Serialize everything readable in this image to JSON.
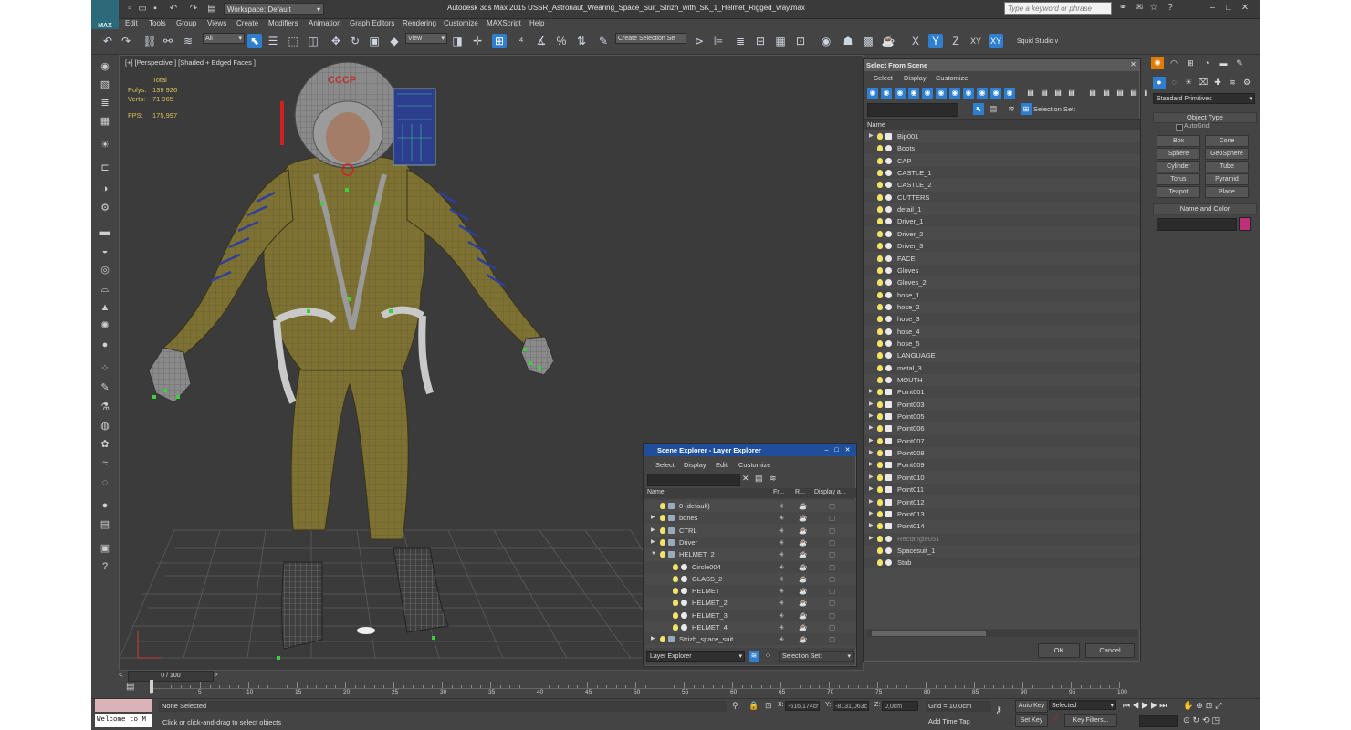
{
  "titlebar": {
    "workspace": "Workspace: Default",
    "app_title": "Autodesk 3ds Max  2015    USSR_Astronaut_Wearing_Space_Suit_Strizh_with_SK_1_Helmet_Rigged_vray.max",
    "search_placeholder": "Type a keyword or phrase",
    "logo": "MAX"
  },
  "menus": [
    "Edit",
    "Tools",
    "Group",
    "Views",
    "Create",
    "Modifiers",
    "Animation",
    "Graph Editors",
    "Rendering",
    "Customize",
    "MAXScript",
    "Help"
  ],
  "toolbar": {
    "filter": "All",
    "ref_coord": "View",
    "selection_set_placeholder": "Create Selection Se",
    "axis_labels": [
      "X",
      "Y",
      "Z",
      "XY",
      "XY"
    ],
    "squid": "Squid Studio v"
  },
  "viewport": {
    "label": "[+] [Perspective ] [Shaded + Edged Faces ]",
    "stats_total": "Total",
    "polys_label": "Polys:",
    "polys_value": "139 926",
    "verts_label": "Verts:",
    "verts_value": "71 965",
    "fps_label": "FPS:",
    "fps_value": "175,997",
    "helmet_text": "СССР"
  },
  "select_from_scene": {
    "title": "Select From Scene",
    "menus": [
      "Select",
      "Display",
      "Customize"
    ],
    "selection_set": "Selection Set:",
    "column_name": "Name",
    "items": [
      {
        "name": "Bip001",
        "expand": true,
        "icon": "bone"
      },
      {
        "name": "Boots",
        "expand": false,
        "icon": "mesh"
      },
      {
        "name": "CAP",
        "expand": false,
        "icon": "mesh"
      },
      {
        "name": "CASTLE_1",
        "expand": false,
        "icon": "mesh"
      },
      {
        "name": "CASTLE_2",
        "expand": false,
        "icon": "mesh"
      },
      {
        "name": "CUTTERS",
        "expand": false,
        "icon": "mesh"
      },
      {
        "name": "detail_1",
        "expand": false,
        "icon": "mesh"
      },
      {
        "name": "Driver_1",
        "expand": false,
        "icon": "mesh"
      },
      {
        "name": "Driver_2",
        "expand": false,
        "icon": "mesh"
      },
      {
        "name": "Driver_3",
        "expand": false,
        "icon": "mesh"
      },
      {
        "name": "FACE",
        "expand": false,
        "icon": "mesh"
      },
      {
        "name": "Gloves",
        "expand": false,
        "icon": "mesh"
      },
      {
        "name": "Gloves_2",
        "expand": false,
        "icon": "mesh"
      },
      {
        "name": "hose_1",
        "expand": false,
        "icon": "mesh"
      },
      {
        "name": "hose_2",
        "expand": false,
        "icon": "mesh"
      },
      {
        "name": "hose_3",
        "expand": false,
        "icon": "mesh"
      },
      {
        "name": "hose_4",
        "expand": false,
        "icon": "mesh"
      },
      {
        "name": "hose_5",
        "expand": false,
        "icon": "mesh"
      },
      {
        "name": "LANGUAGE",
        "expand": false,
        "icon": "mesh"
      },
      {
        "name": "metal_3",
        "expand": false,
        "icon": "mesh"
      },
      {
        "name": "MOUTH",
        "expand": false,
        "icon": "mesh"
      },
      {
        "name": "Point001",
        "expand": true,
        "icon": "helper"
      },
      {
        "name": "Point003",
        "expand": true,
        "icon": "helper"
      },
      {
        "name": "Point005",
        "expand": true,
        "icon": "helper"
      },
      {
        "name": "Point006",
        "expand": true,
        "icon": "helper"
      },
      {
        "name": "Point007",
        "expand": true,
        "icon": "helper"
      },
      {
        "name": "Point008",
        "expand": true,
        "icon": "helper"
      },
      {
        "name": "Point009",
        "expand": true,
        "icon": "helper"
      },
      {
        "name": "Point010",
        "expand": true,
        "icon": "helper"
      },
      {
        "name": "Point011",
        "expand": true,
        "icon": "helper"
      },
      {
        "name": "Point012",
        "expand": true,
        "icon": "helper"
      },
      {
        "name": "Point013",
        "expand": true,
        "icon": "helper"
      },
      {
        "name": "Point014",
        "expand": true,
        "icon": "helper"
      },
      {
        "name": "Rectangle051",
        "expand": true,
        "icon": "shape",
        "dim": true
      },
      {
        "name": "Spacesuit_1",
        "expand": false,
        "icon": "mesh"
      },
      {
        "name": "Stub",
        "expand": false,
        "icon": "mesh"
      }
    ],
    "ok": "OK",
    "cancel": "Cancel"
  },
  "scene_explorer": {
    "title": "Scene Explorer - Layer Explorer",
    "menus": [
      "Select",
      "Display",
      "Edit",
      "Customize"
    ],
    "columns": [
      "Name",
      "Fr...",
      "R...",
      "Display a..."
    ],
    "items": [
      {
        "name": "0 (default)",
        "indent": 0,
        "type": "layer",
        "expand": false
      },
      {
        "name": "bones",
        "indent": 0,
        "type": "layer",
        "expand": true
      },
      {
        "name": "CTRL",
        "indent": 0,
        "type": "layer",
        "expand": true
      },
      {
        "name": "Driver",
        "indent": 0,
        "type": "layer",
        "expand": true
      },
      {
        "name": "HELMET_2",
        "indent": 0,
        "type": "layer",
        "expand": true,
        "open": true
      },
      {
        "name": "Circle004",
        "indent": 1,
        "type": "shape",
        "expand": false
      },
      {
        "name": "GLASS_2",
        "indent": 1,
        "type": "mesh",
        "expand": false
      },
      {
        "name": "HELMET",
        "indent": 1,
        "type": "mesh",
        "expand": false
      },
      {
        "name": "HELMET_2",
        "indent": 1,
        "type": "mesh",
        "expand": false
      },
      {
        "name": "HELMET_3",
        "indent": 1,
        "type": "mesh",
        "expand": false
      },
      {
        "name": "HELMET_4",
        "indent": 1,
        "type": "mesh",
        "expand": false
      },
      {
        "name": "Strizh_space_suit",
        "indent": 0,
        "type": "layer",
        "expand": true
      }
    ],
    "footer_dropdown": "Layer Explorer",
    "selection_set": "Selection Set:"
  },
  "command_panel": {
    "dropdown": "Standard Primitives",
    "object_type": "Object Type",
    "autogrid": "AutoGrid",
    "buttons": [
      "Box",
      "Cone",
      "Sphere",
      "GeoSphere",
      "Cylinder",
      "Tube",
      "Torus",
      "Pyramid",
      "Teapot",
      "Plane"
    ],
    "name_and_color": "Name and Color",
    "swatch_color": "#c0307a"
  },
  "timeline": {
    "frame_counter": "0 / 100",
    "ticks": [
      "0",
      "5",
      "10",
      "15",
      "20",
      "25",
      "30",
      "35",
      "40",
      "45",
      "50",
      "55",
      "60",
      "65",
      "70",
      "75",
      "80",
      "85",
      "90",
      "95",
      "100"
    ]
  },
  "status": {
    "maxscript": "Welcome to M",
    "none_selected": "None Selected",
    "prompt": "Click or click-and-drag to select objects",
    "x_label": "X:",
    "x_value": "-616,174cr",
    "y_label": "Y:",
    "y_value": "-8131,063c",
    "z_label": "Z:",
    "z_value": "0,0cm",
    "grid": "Grid = 10,0cm",
    "add_time_tag": "Add Time Tag",
    "auto_key": "Auto Key",
    "set_key": "Set Key",
    "selected": "Selected",
    "key_filters": "Key Filters..."
  },
  "colors": {
    "accent": "#2f7fd0",
    "orange_tab": "#e07b00",
    "stats": "#d6c15c",
    "suit": "#7d7133"
  }
}
